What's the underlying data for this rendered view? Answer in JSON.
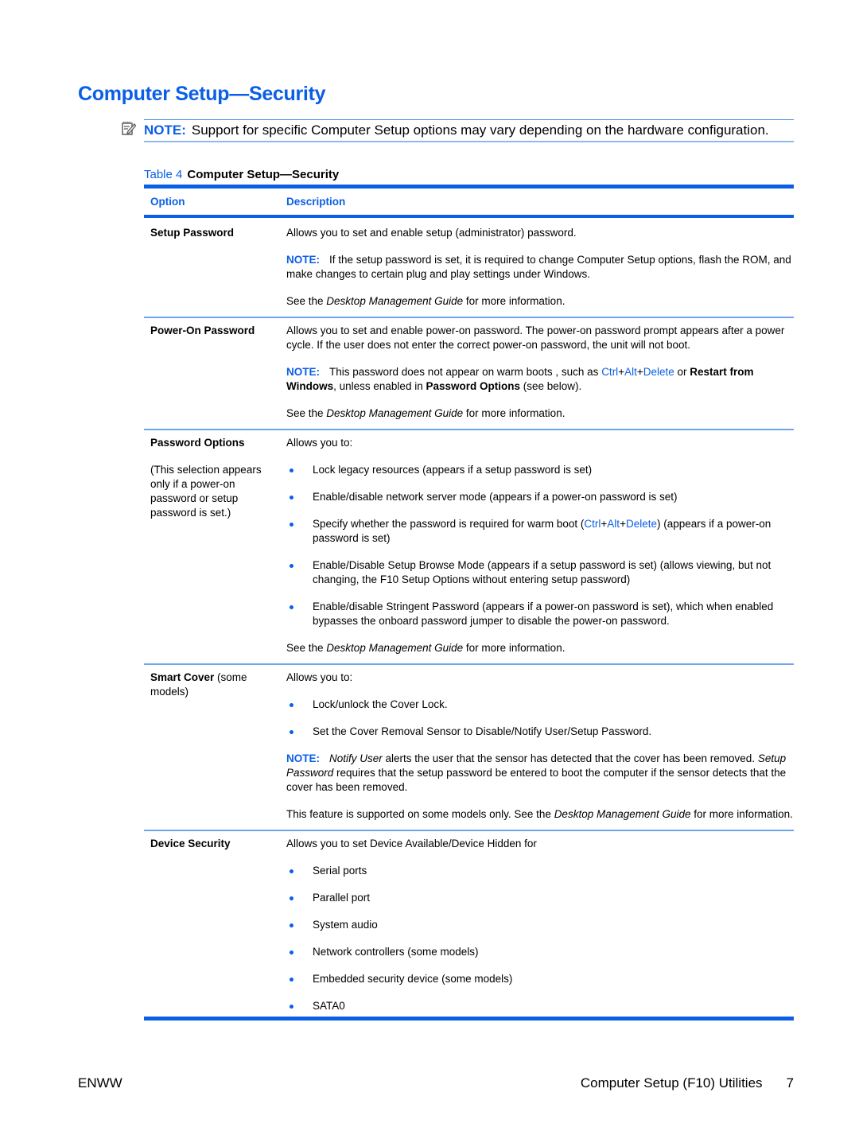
{
  "page_title": "Computer Setup—Security",
  "note": {
    "icon": "note-pencil-icon",
    "label": "NOTE:",
    "text": "Support for specific Computer Setup options may vary depending on the hardware configuration."
  },
  "table": {
    "number": "Table 4",
    "title": "Computer Setup—Security",
    "headers": [
      "Option",
      "Description"
    ],
    "rows": {
      "setup_password": {
        "option": "Setup Password",
        "desc": "Allows you to set and enable setup (administrator) password.",
        "note_label": "NOTE:",
        "note": "If the setup password is set, it is required to change Computer Setup options, flash the ROM, and make changes to certain plug and play settings under Windows.",
        "see_pre": "See the ",
        "see_guide": "Desktop Management Guide",
        "see_post": " for more information."
      },
      "power_on_password": {
        "option": "Power-On Password",
        "desc": "Allows you to set and enable power-on password. The power-on password prompt appears after a power cycle. If the user does not enter the correct power-on password, the unit will not boot.",
        "note_label": "NOTE:",
        "note_pre": "This password does not appear on warm boots , such as ",
        "ctrl": "Ctrl",
        "plus": "+",
        "alt": "Alt",
        "delete": "Delete",
        "note_or": " or ",
        "restart": "Restart from Windows",
        "note_mid": ", unless enabled in ",
        "password_options": "Password Options",
        "note_post": " (see below).",
        "see_pre": "See the ",
        "see_guide": "Desktop Management Guide",
        "see_post": " for more information."
      },
      "password_options": {
        "option": "Password Options",
        "option_sub": "(This selection appears only if a power-on password or setup password is set.)",
        "desc": "Allows you to:",
        "bullets": [
          "Lock legacy resources (appears if a setup password is set)",
          "Enable/disable network server mode (appears if a power-on password is set)",
          "Enable/Disable Setup Browse Mode (appears if a setup password is set) (allows viewing, but not changing, the F10 Setup Options without entering setup password)",
          "Enable/disable Stringent Password (appears if a power-on password is set), which when enabled bypasses the onboard password jumper to disable the power-on password."
        ],
        "warm_boot_pre": "Specify whether the password is required for warm boot (",
        "ctrl": "Ctrl",
        "plus": "+",
        "alt": "Alt",
        "delete": "Delete",
        "warm_boot_post": ") (appears if a power-on password is set)",
        "see_pre": "See the ",
        "see_guide": "Desktop Management Guide",
        "see_post": " for more information."
      },
      "smart_cover": {
        "option": "Smart Cover",
        "option_suffix": " (some models)",
        "desc": "Allows you to:",
        "bullets": [
          "Lock/unlock the Cover Lock.",
          "Set the Cover Removal Sensor to Disable/Notify User/Setup Password."
        ],
        "note_label": "NOTE:",
        "notify_user": "Notify User",
        "note_mid": " alerts the user that the sensor has detected that the cover has been removed. ",
        "setup_password": "Setup Password",
        "note_post": " requires that the setup password be entered to boot the computer if the sensor detects that the cover has been removed.",
        "support_pre": "This feature is supported on some models only. See the ",
        "see_guide": "Desktop Management Guide",
        "support_post": " for more information."
      },
      "device_security": {
        "option": "Device Security",
        "desc": "Allows you to set Device Available/Device Hidden for",
        "bullets": [
          "Serial ports",
          "Parallel port",
          "System audio",
          "Network controllers (some models)",
          "Embedded security device (some models)",
          "SATA0"
        ]
      }
    }
  },
  "footer": {
    "left": "ENWW",
    "section": "Computer Setup (F10) Utilities",
    "page": "7"
  }
}
